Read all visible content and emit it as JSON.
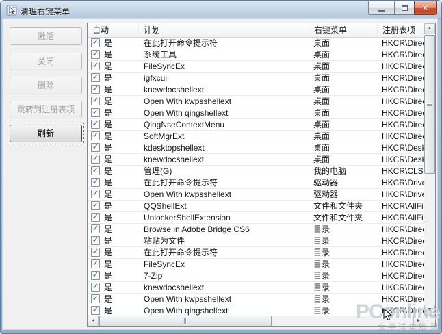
{
  "window": {
    "title": "清理右键菜单",
    "controls": {
      "minimize": "minimize",
      "maximize": "maximize",
      "close_glyph": "✕"
    }
  },
  "sidebar": {
    "buttons": [
      {
        "label": "激活",
        "enabled": false
      },
      {
        "label": "关闭",
        "enabled": false
      },
      {
        "label": "删除",
        "enabled": false
      },
      {
        "label": "跳转到注册表项",
        "enabled": false
      },
      {
        "label": "刷新",
        "enabled": true,
        "focused": true
      }
    ]
  },
  "table": {
    "headers": [
      "自动",
      "计划",
      "右键菜单",
      "注册表项"
    ],
    "checkbox_glyph": "✓",
    "rows": [
      {
        "checked": true,
        "auto": "是",
        "plan": "在此打开命令提示符",
        "menu": "桌面",
        "registry": "HKCR\\Direct"
      },
      {
        "checked": true,
        "auto": "是",
        "plan": "系统工具",
        "menu": "桌面",
        "registry": "HKCR\\Direct"
      },
      {
        "checked": true,
        "auto": "是",
        "plan": " FileSyncEx",
        "menu": "桌面",
        "registry": "HKCR\\Direct"
      },
      {
        "checked": true,
        "auto": "是",
        "plan": "igfxcui",
        "menu": "桌面",
        "registry": "HKCR\\Direct"
      },
      {
        "checked": true,
        "auto": "是",
        "plan": "knewdocshellext",
        "menu": "桌面",
        "registry": "HKCR\\Direct"
      },
      {
        "checked": true,
        "auto": "是",
        "plan": "Open With kwpsshellext",
        "menu": "桌面",
        "registry": "HKCR\\Direct"
      },
      {
        "checked": true,
        "auto": "是",
        "plan": "Open With qingshellext",
        "menu": "桌面",
        "registry": "HKCR\\Direct"
      },
      {
        "checked": true,
        "auto": "是",
        "plan": "QingNseContextMenu",
        "menu": "桌面",
        "registry": "HKCR\\Direct"
      },
      {
        "checked": true,
        "auto": "是",
        "plan": "SoftMgrExt",
        "menu": "桌面",
        "registry": "HKCR\\Direct"
      },
      {
        "checked": true,
        "auto": "是",
        "plan": "kdesktopshellext",
        "menu": "桌面",
        "registry": "HKCR\\Deskto"
      },
      {
        "checked": true,
        "auto": "是",
        "plan": "knewdocshellext",
        "menu": "桌面",
        "registry": "HKCR\\Deskto"
      },
      {
        "checked": true,
        "auto": "是",
        "plan": "管理(G)",
        "menu": "我的电脑",
        "registry": "HKCR\\CLSID\\"
      },
      {
        "checked": true,
        "auto": "是",
        "plan": "在此打开命令提示符",
        "menu": "驱动器",
        "registry": "HKCR\\Drive\\"
      },
      {
        "checked": true,
        "auto": "是",
        "plan": "Open With kwpsshellext",
        "menu": "驱动器",
        "registry": "HKCR\\Drive\\"
      },
      {
        "checked": true,
        "auto": "是",
        "plan": "QQShellExt",
        "menu": "文件和文件夹",
        "registry": "HKCR\\AllFiles"
      },
      {
        "checked": true,
        "auto": "是",
        "plan": "UnlockerShellExtension",
        "menu": "文件和文件夹",
        "registry": "HKCR\\AllFiles"
      },
      {
        "checked": true,
        "auto": "是",
        "plan": "Browse in Adobe Bridge CS6",
        "menu": "目录",
        "registry": "HKCR\\Direct"
      },
      {
        "checked": true,
        "auto": "是",
        "plan": "粘贴为文件",
        "menu": "目录",
        "registry": "HKCR\\Direct"
      },
      {
        "checked": true,
        "auto": "是",
        "plan": "在此打开命令提示符",
        "menu": "目录",
        "registry": "HKCR\\Direct"
      },
      {
        "checked": true,
        "auto": "是",
        "plan": " FileSyncEx",
        "menu": "目录",
        "registry": "HKCR\\Direct"
      },
      {
        "checked": true,
        "auto": "是",
        "plan": "7-Zip",
        "menu": "目录",
        "registry": "HKCR\\Direct"
      },
      {
        "checked": true,
        "auto": "是",
        "plan": "knewdocshellext",
        "menu": "目录",
        "registry": "HKCR\\Direct"
      },
      {
        "checked": true,
        "auto": "是",
        "plan": "Open With kwpsshellext",
        "menu": "目录",
        "registry": "HKCR\\Direct"
      },
      {
        "checked": true,
        "auto": "是",
        "plan": "Open With qingshellext",
        "menu": "目录",
        "registry": "HKCR\\Direct"
      }
    ]
  },
  "scrollbars": {
    "up_arrow": "▲",
    "down_arrow": "▼",
    "left_arrow": "◄",
    "right_arrow": "►"
  },
  "watermark": {
    "line1": "PConline",
    "line2": "太平洋电脑网"
  },
  "colors": {
    "titlebar_top": "#dde8f2",
    "titlebar_bottom": "#b4c8dc",
    "frame_border": "#5a7da0",
    "close_button_red": "#d2542f",
    "client_bg": "#f0f0f0",
    "list_border": "#828790",
    "checkbox_check": "#29497f",
    "disabled_text": "#9f9f9f"
  }
}
